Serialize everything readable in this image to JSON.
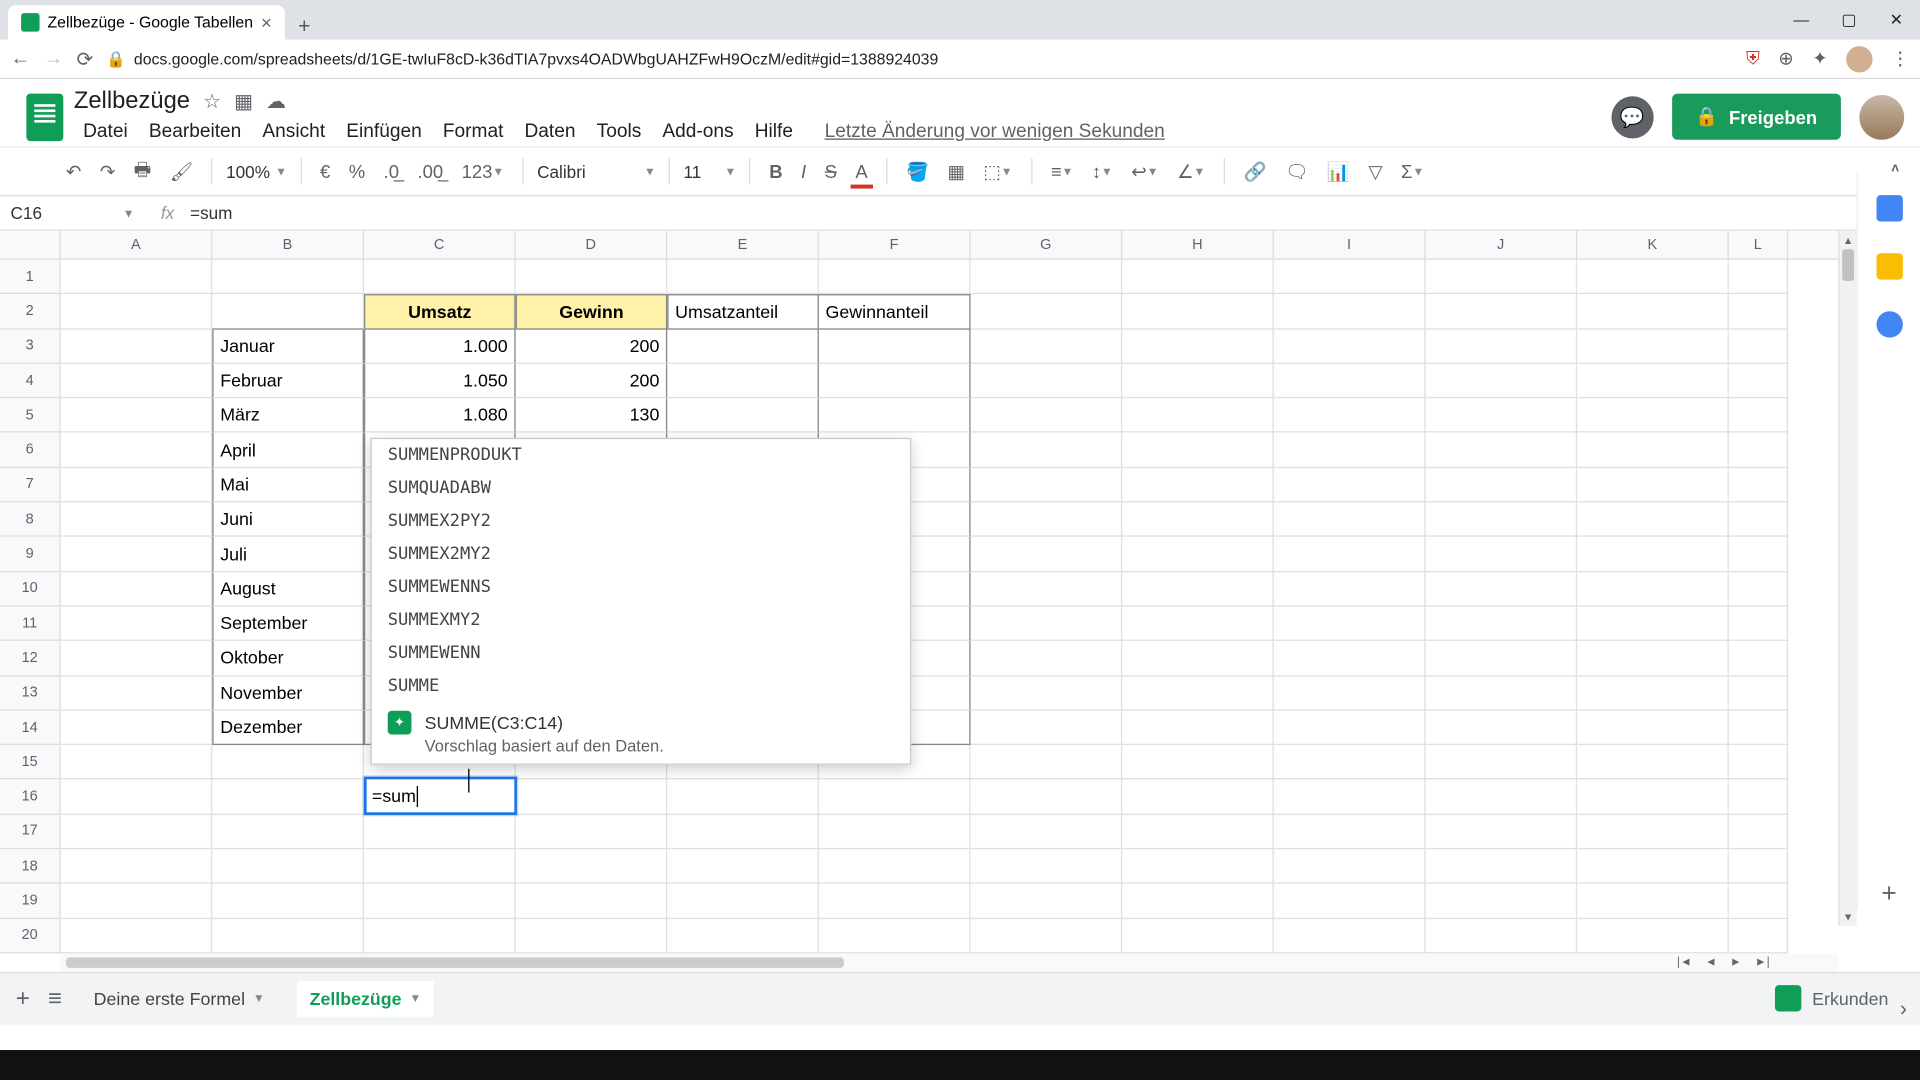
{
  "browser": {
    "tab_title": "Zellbezüge - Google Tabellen",
    "url": "docs.google.com/spreadsheets/d/1GE-twIuF8cD-k36dTIA7pvxs4OADWbgUAHZFwH9OczM/edit#gid=1388924039"
  },
  "doc": {
    "title": "Zellbezüge",
    "status": "Letzte Änderung vor wenigen Sekunden",
    "share": "Freigeben"
  },
  "menus": [
    "Datei",
    "Bearbeiten",
    "Ansicht",
    "Einfügen",
    "Format",
    "Daten",
    "Tools",
    "Add-ons",
    "Hilfe"
  ],
  "toolbar": {
    "zoom": "100%",
    "currency": "€",
    "percent": "%",
    "dec_dec": ".0",
    "inc_dec": ".00",
    "numfmt": "123",
    "font": "Calibri",
    "size": "11"
  },
  "namebox": "C16",
  "formula": "=sum",
  "cols": [
    "A",
    "B",
    "C",
    "D",
    "E",
    "F",
    "G",
    "H",
    "I",
    "J",
    "K",
    "L"
  ],
  "rows": [
    "1",
    "2",
    "3",
    "4",
    "5",
    "6",
    "7",
    "8",
    "9",
    "10",
    "11",
    "12",
    "13",
    "14",
    "15",
    "16",
    "17",
    "18",
    "19",
    "20"
  ],
  "headers": {
    "c": "Umsatz",
    "d": "Gewinn",
    "e": "Umsatzanteil",
    "f": "Gewinnanteil"
  },
  "data": [
    {
      "b": "Januar",
      "c": "1.000",
      "d": "200"
    },
    {
      "b": "Februar",
      "c": "1.050",
      "d": "200"
    },
    {
      "b": "März",
      "c": "1.080",
      "d": "130"
    },
    {
      "b": "April"
    },
    {
      "b": "Mai"
    },
    {
      "b": "Juni"
    },
    {
      "b": "Juli"
    },
    {
      "b": "August"
    },
    {
      "b": "September"
    },
    {
      "b": "Oktober"
    },
    {
      "b": "November"
    },
    {
      "b": "Dezember"
    }
  ],
  "editing": "=sum",
  "autocomplete": {
    "items": [
      "SUMMENPRODUKT",
      "SUMQUADABW",
      "SUMMEX2PY2",
      "SUMMEX2MY2",
      "SUMMEWENNS",
      "SUMMEXMY2",
      "SUMMEWENN",
      "SUMME"
    ],
    "suggest": "SUMME(C3:C14)",
    "hint": "Vorschlag basiert auf den Daten."
  },
  "tabs": {
    "t1": "Deine erste Formel",
    "t2": "Zellbezüge"
  },
  "explore": "Erkunden"
}
